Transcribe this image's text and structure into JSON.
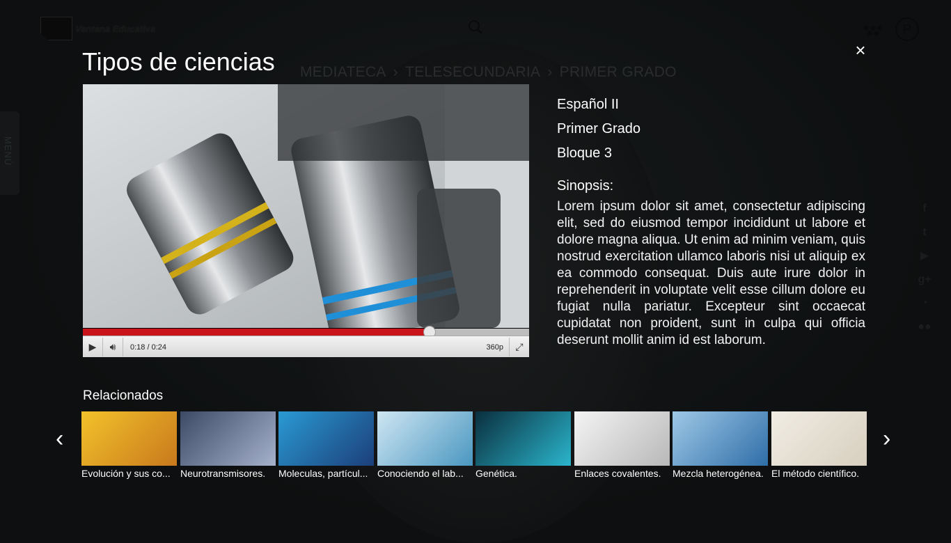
{
  "header": {
    "logo_text": "Ventana Educativa",
    "profile_letter": "P",
    "side_menu_label": "MENÚ"
  },
  "breadcrumb": [
    "MEDIATECA",
    "TELESECUNDARIA",
    "PRIMER GRADO"
  ],
  "modal": {
    "title": "Tipos de ciencias",
    "close_label": "×",
    "subject": "Español II",
    "grade": "Primer Grado",
    "block": "Bloque 3",
    "synopsis_label": "Sinopsis:",
    "synopsis": "Lorem ipsum dolor sit amet, consectetur adipiscing elit, sed do eiusmod tempor incididunt ut labore et dolore magna aliqua. Ut enim ad minim veniam, quis nostrud exercitation ullamco laboris nisi ut aliquip ex ea commodo consequat. Duis aute irure dolor in reprehenderit in voluptate velit esse cillum dolore eu fugiat nulla pariatur. Excepteur sint occaecat cupidatat non proident, sunt in culpa qui officia deserunt mollit anim id est laborum."
  },
  "player": {
    "time": "0:18 / 0:24",
    "quality": "360p",
    "progress": 0.775
  },
  "related": {
    "title": "Relacionados",
    "items": [
      {
        "label": "Evolución y sus co...",
        "thumb": [
          "#f2c22a",
          "#c9791d"
        ]
      },
      {
        "label": "Neurotransmisores.",
        "thumb": [
          "#3c4a66",
          "#a6b2cc"
        ]
      },
      {
        "label": "Moleculas, partícul...",
        "thumb": [
          "#2a9ad2",
          "#1c3f7a"
        ]
      },
      {
        "label": "Conociendo el lab...",
        "thumb": [
          "#cfe6f2",
          "#4a97c0"
        ]
      },
      {
        "label": "Genética.",
        "thumb": [
          "#0a2f3e",
          "#2bb5cc"
        ]
      },
      {
        "label": "Enlaces covalentes.",
        "thumb": [
          "#f4f4f4",
          "#b8b8b8"
        ]
      },
      {
        "label": "Mezcla heterogénea.",
        "thumb": [
          "#9ec8e6",
          "#2f6ea8"
        ]
      },
      {
        "label": "El método científico.",
        "thumb": [
          "#f1ede4",
          "#d7cfbf"
        ]
      }
    ]
  },
  "colors": {
    "background": "#0d0f10",
    "progress": "#c8141a",
    "accent_text": "#ffffff"
  }
}
